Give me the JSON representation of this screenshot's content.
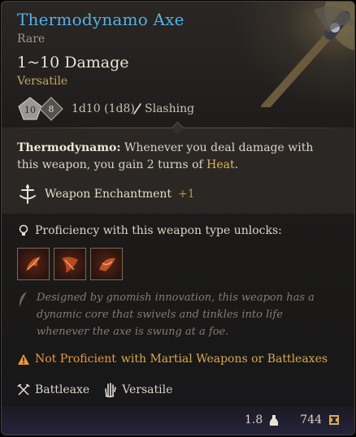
{
  "item": {
    "name": "Thermodynamo Axe",
    "rarity": "Rare",
    "damage": "1~10 Damage",
    "tag": "Versatile",
    "dice": [
      "10",
      "8"
    ],
    "damage_detail": "1d10 (1d8)",
    "damage_type": "Slashing"
  },
  "passive": {
    "name": "Thermodynamo:",
    "text_before": " Whenever you deal damage with this weapon, you gain 2 turns of ",
    "keyword": "Heat",
    "text_after": "."
  },
  "enchantment": {
    "label": "Weapon Enchantment",
    "value": "+1"
  },
  "proficiency": {
    "label": "Proficiency with this weapon type unlocks:"
  },
  "unlocks": [
    "action-icon-1",
    "action-icon-2",
    "action-icon-3"
  ],
  "description": "Designed by gnomish innovation, this weapon has a dynamic core that swivels and tinkles into life whenever the axe is swung at a foe.",
  "warning": {
    "part1": "Not Proficient",
    "part2": " with Martial Weapons or Battleaxes"
  },
  "properties": [
    {
      "label": "Battleaxe",
      "icon": "crossed-axes-icon"
    },
    {
      "label": "Versatile",
      "icon": "hand-icon"
    }
  ],
  "footer": {
    "weight": "1.8",
    "value": "744"
  },
  "colors": {
    "title": "#4fb3e8",
    "accent": "#c7a85a",
    "warning": "#e89a3a"
  }
}
